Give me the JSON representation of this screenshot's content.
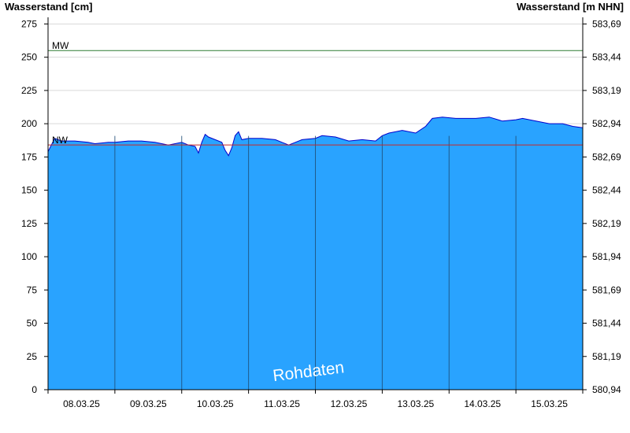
{
  "chart_data": {
    "type": "area",
    "ylabel_left": "Wasserstand [cm]",
    "ylabel_right": "Wasserstand [m NHN]",
    "ylim": [
      0,
      280
    ],
    "yticks_left": [
      0,
      25,
      50,
      75,
      100,
      125,
      150,
      175,
      200,
      225,
      250,
      275
    ],
    "yticks_right": [
      "580,94",
      "581,19",
      "581,44",
      "581,69",
      "581,94",
      "582,19",
      "582,44",
      "582,69",
      "582,94",
      "583,19",
      "583,44",
      "583,69"
    ],
    "xlim_days": [
      0,
      8
    ],
    "x_tick_labels": [
      "08.03.25",
      "09.03.25",
      "10.03.25",
      "11.03.25",
      "12.03.25",
      "13.03.25",
      "14.03.25",
      "15.03.25"
    ],
    "reference_lines": [
      {
        "label": "MW",
        "value": 255,
        "color": "#2e7d32"
      },
      {
        "label": "NW",
        "value": 184,
        "color": "#c62828"
      }
    ],
    "watermark": "Rohdaten",
    "fill_color": "#29a3ff",
    "line_color": "#0000cc",
    "series": [
      {
        "x": [
          0,
          0.05,
          0.1,
          0.2,
          0.4,
          0.6,
          0.7,
          0.9,
          1.0,
          1.2,
          1.4,
          1.6,
          1.8,
          2.0,
          2.1,
          2.2,
          2.25,
          2.3,
          2.35,
          2.4,
          2.5,
          2.6,
          2.65,
          2.7,
          2.75,
          2.8,
          2.85,
          2.9,
          3.0,
          3.2,
          3.4,
          3.5,
          3.6,
          3.8,
          4.0,
          4.1,
          4.3,
          4.5,
          4.7,
          4.9,
          5.0,
          5.1,
          5.3,
          5.5,
          5.65,
          5.75,
          5.9,
          6.1,
          6.2,
          6.4,
          6.6,
          6.8,
          7.0,
          7.1,
          7.3,
          7.5,
          7.7,
          7.85,
          8.0
        ],
        "values": [
          179,
          184,
          189,
          187,
          187,
          186,
          185,
          186,
          186,
          187,
          187,
          186,
          184,
          186,
          184,
          183,
          178,
          186,
          192,
          190,
          188,
          186,
          180,
          176,
          182,
          191,
          194,
          188,
          189,
          189,
          188,
          186,
          184,
          188,
          189,
          191,
          190,
          187,
          188,
          187,
          191,
          193,
          195,
          193,
          198,
          204,
          205,
          204,
          204,
          204,
          205,
          202,
          203,
          204,
          202,
          200,
          200,
          198,
          197
        ]
      }
    ]
  }
}
